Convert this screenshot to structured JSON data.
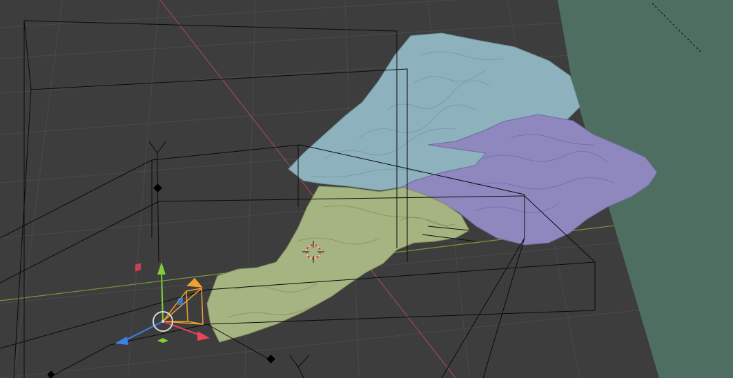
{
  "viewport": {
    "background": "#3d3d3d",
    "grid_color": "#4a4a4a"
  },
  "axes": {
    "x_axis_color": "#9a4a52",
    "y_axis_color": "#7a9a3a"
  },
  "terrain": {
    "teal": "#8db2bd",
    "purple": "#8f88bf",
    "green": "#a6b482"
  },
  "plane_color": "#4e6e62",
  "gizmo": {
    "icons": [
      "move-x-arrow-icon",
      "move-y-arrow-icon",
      "move-z-arrow-icon",
      "rotate-circle-icon",
      "camera-icon"
    ],
    "colors": {
      "x": "#e8445a",
      "y": "#7fcf3a",
      "z": "#3a82e8",
      "camera": "#f0a030",
      "center": "#d8d8d8"
    }
  },
  "cursor": {
    "icon": "3d-cursor-icon",
    "colors": [
      "#e04040",
      "#f0f0f0"
    ]
  }
}
